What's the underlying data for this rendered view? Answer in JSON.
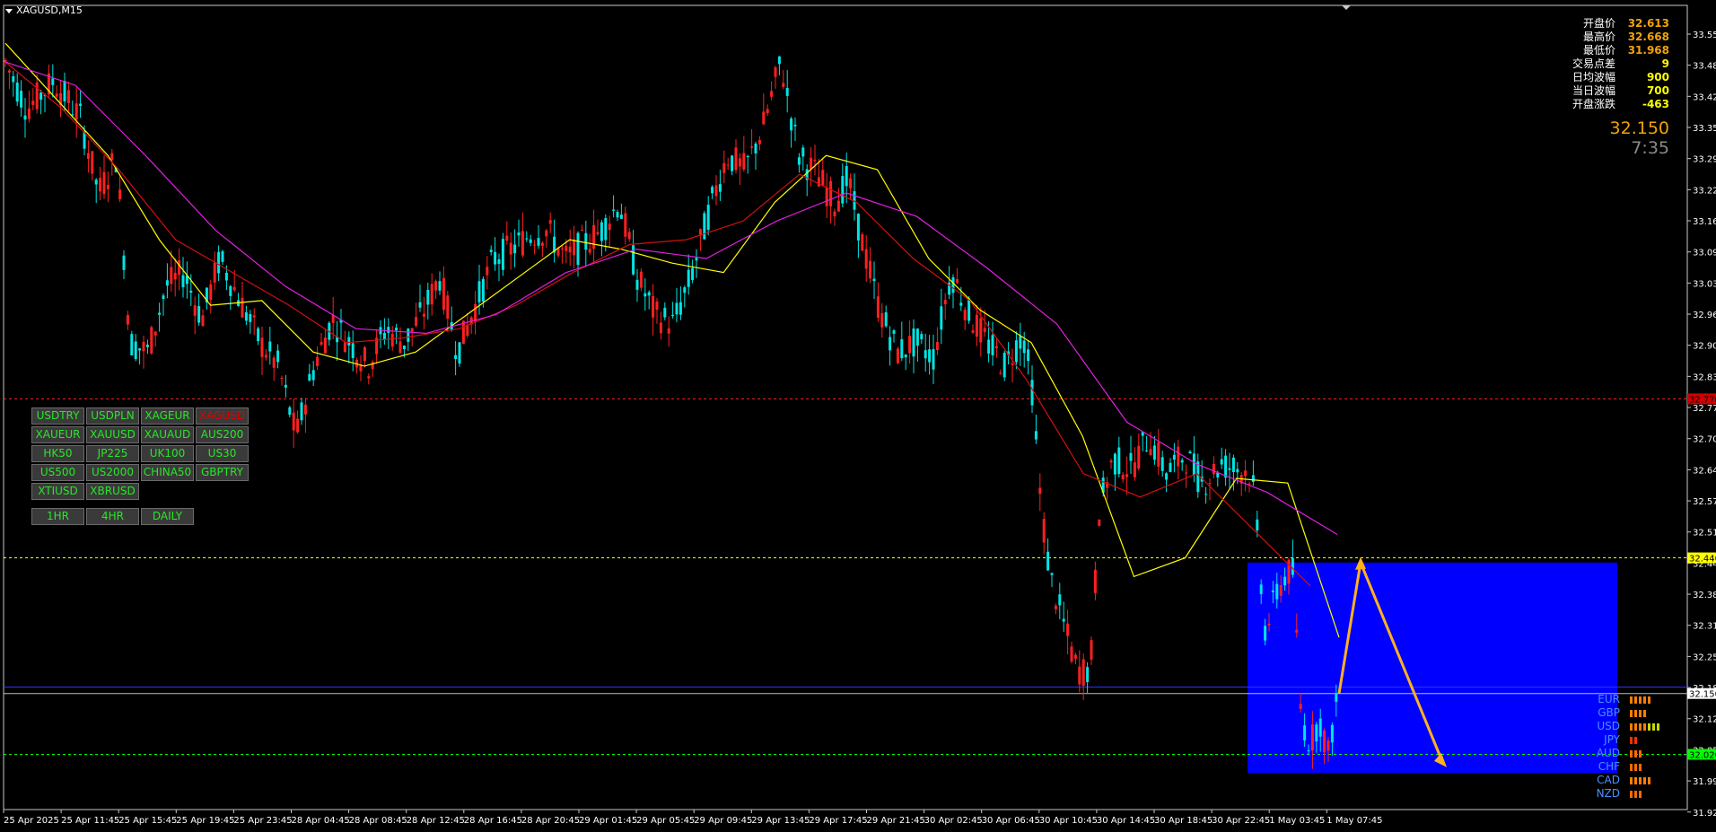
{
  "title": "XAGUSD,M15",
  "info_panel": [
    {
      "label": "开盘价",
      "value": "32.613",
      "color": "#f0a30a"
    },
    {
      "label": "最高价",
      "value": "32.668",
      "color": "#f0a30a"
    },
    {
      "label": "最低价",
      "value": "31.968",
      "color": "#f0a30a"
    },
    {
      "label": "交易点差",
      "value": "9",
      "color": "#ffff00"
    },
    {
      "label": "日均波幅",
      "value": "900",
      "color": "#ffff00"
    },
    {
      "label": "当日波幅",
      "value": "700",
      "color": "#ffff00"
    },
    {
      "label": "开盘涨跌",
      "value": "-463",
      "color": "#ffff00"
    }
  ],
  "current_price": "32.150",
  "countdown": "7:35",
  "symbol_buttons": [
    "USDTRY",
    "USDPLN",
    "XAGEUR",
    "XAGUSD",
    "XAUEUR",
    "XAUUSD",
    "XAUAUD",
    "AUS200",
    "HK50",
    "JP225",
    "UK100",
    "US30",
    "US500",
    "US2000",
    "CHINA50",
    "GBPTRY",
    "XTIUSD",
    "XBRUSD"
  ],
  "active_symbol": "XAGUSD",
  "timeframe_buttons": [
    "1HR",
    "4HR",
    "DAILY"
  ],
  "currency_strength": [
    {
      "name": "EUR",
      "bars": 5,
      "color": "#ff7f00"
    },
    {
      "name": "GBP",
      "bars": 4,
      "color": "#ff7f00"
    },
    {
      "name": "USD",
      "bars": 7,
      "color": "#ff7f00"
    },
    {
      "name": "JPY",
      "bars": 2,
      "color": "#ff3000"
    },
    {
      "name": "AUD",
      "bars": 3,
      "color": "#ff6a00"
    },
    {
      "name": "CHF",
      "bars": 3,
      "color": "#ff6a00"
    },
    {
      "name": "CAD",
      "bars": 5,
      "color": "#ff7f00"
    },
    {
      "name": "NZD",
      "bars": 3,
      "color": "#ff6a00"
    }
  ],
  "chart_data": {
    "type": "candlestick",
    "y_ticks": [
      "33.550",
      "33.485",
      "33.420",
      "33.355",
      "33.290",
      "33.225",
      "33.160",
      "33.095",
      "33.030",
      "32.965",
      "32.900",
      "32.835",
      "32.770",
      "32.705",
      "32.640",
      "32.575",
      "32.510",
      "32.445",
      "32.380",
      "32.315",
      "32.250",
      "32.185",
      "32.120",
      "32.055",
      "31.990",
      "31.925"
    ],
    "x_ticks": [
      "25 Apr 2025",
      "25 Apr 11:45",
      "25 Apr 15:45",
      "25 Apr 19:45",
      "25 Apr 23:45",
      "28 Apr 04:45",
      "28 Apr 08:45",
      "28 Apr 12:45",
      "28 Apr 16:45",
      "28 Apr 20:45",
      "29 Apr 01:45",
      "29 Apr 05:45",
      "29 Apr 09:45",
      "29 Apr 13:45",
      "29 Apr 17:45",
      "29 Apr 21:45",
      "30 Apr 02:45",
      "30 Apr 06:45",
      "30 Apr 10:45",
      "30 Apr 14:45",
      "30 Apr 18:45",
      "30 Apr 22:45",
      "1 May 03:45",
      "1 May 07:45"
    ],
    "ylim": [
      31.9,
      33.6
    ],
    "price_lines": [
      {
        "value": 32.78,
        "label": "32.770",
        "color": "#ff2020",
        "style": "dashed"
      },
      {
        "value": 32.44,
        "label": "32.440",
        "color": "#ffff00",
        "style": "dashed"
      },
      {
        "value": 32.15,
        "label": "32.150",
        "color": "#c0c0c0",
        "style": "solid"
      },
      {
        "value": 32.02,
        "label": "32.020",
        "color": "#00ff00",
        "style": "dashed"
      }
    ],
    "ma_yellow": [
      33.54,
      33.42,
      33.3,
      33.12,
      32.98,
      32.99,
      32.88,
      32.85,
      32.88,
      32.96,
      33.04,
      33.12,
      33.1,
      33.07,
      33.05,
      33.2,
      33.3,
      33.27,
      33.08,
      32.97,
      32.9,
      32.7,
      32.4,
      32.44,
      32.61,
      32.6,
      32.27
    ],
    "ma_red": [
      33.5,
      33.4,
      33.27,
      33.12,
      33.05,
      32.98,
      32.9,
      32.91,
      32.93,
      32.98,
      33.05,
      33.11,
      33.12,
      33.16,
      33.26,
      33.2,
      33.08,
      32.99,
      32.82,
      32.62,
      32.57,
      32.62,
      32.5,
      32.38
    ],
    "ma_magenta": [
      33.5,
      33.45,
      33.3,
      33.14,
      33.02,
      32.93,
      32.92,
      32.96,
      33.05,
      33.1,
      33.08,
      33.16,
      33.22,
      33.17,
      33.06,
      32.94,
      32.73,
      32.64,
      32.58,
      32.49
    ],
    "forecast": [
      32.15,
      32.43,
      32.0
    ],
    "box_range": [
      31.98,
      32.43
    ]
  }
}
